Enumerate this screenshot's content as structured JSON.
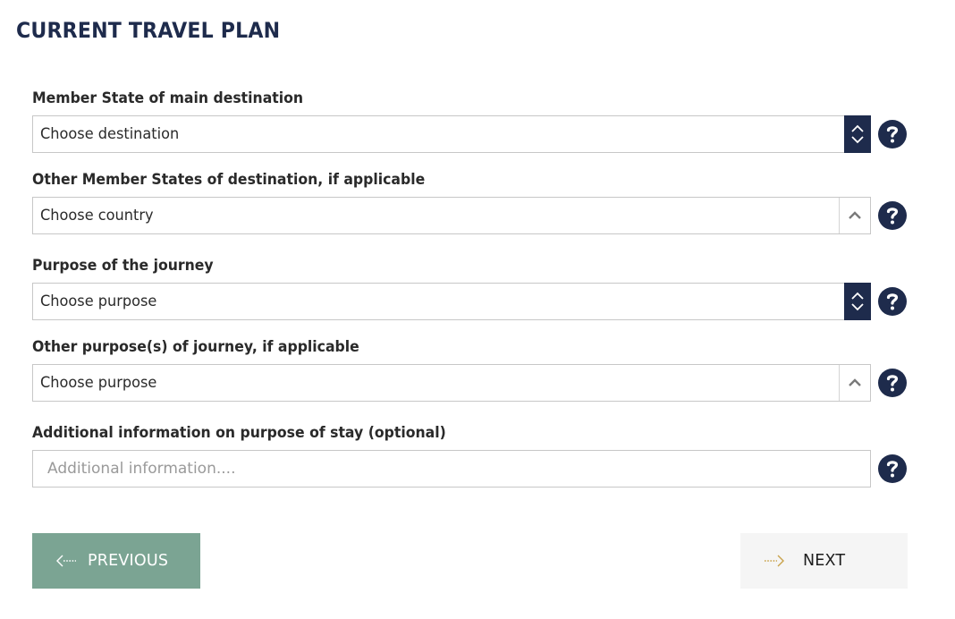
{
  "page_title": "CURRENT TRAVEL PLAN",
  "fields": [
    {
      "label": "Member State of main destination",
      "value": "Choose destination",
      "control": "spinner-select"
    },
    {
      "label": "Other Member States of destination, if applicable",
      "value": "Choose country",
      "control": "multi-select"
    },
    {
      "label": "Purpose of the journey",
      "value": "Choose purpose",
      "control": "spinner-select"
    },
    {
      "label": "Other purpose(s) of journey, if applicable",
      "value": "Choose purpose",
      "control": "multi-select"
    },
    {
      "label": "Additional information on purpose of stay (optional)",
      "placeholder": "Additional information....",
      "value": "",
      "control": "text-input"
    }
  ],
  "buttons": {
    "previous_label": "PREVIOUS",
    "next_label": "NEXT"
  },
  "icons": {
    "help": "question-mark-circle-icon",
    "spinner": "chevron-up-down-icon",
    "caret": "chevron-up-icon",
    "previous": "dotted-arrow-left-icon",
    "next": "dotted-arrow-right-icon"
  },
  "colors": {
    "brand_navy": "#1e2b4c",
    "previous_button_bg": "#7ba493",
    "next_button_bg": "#f5f5f5",
    "next_arrow": "#c9a24a",
    "border": "#c7c7c7"
  }
}
